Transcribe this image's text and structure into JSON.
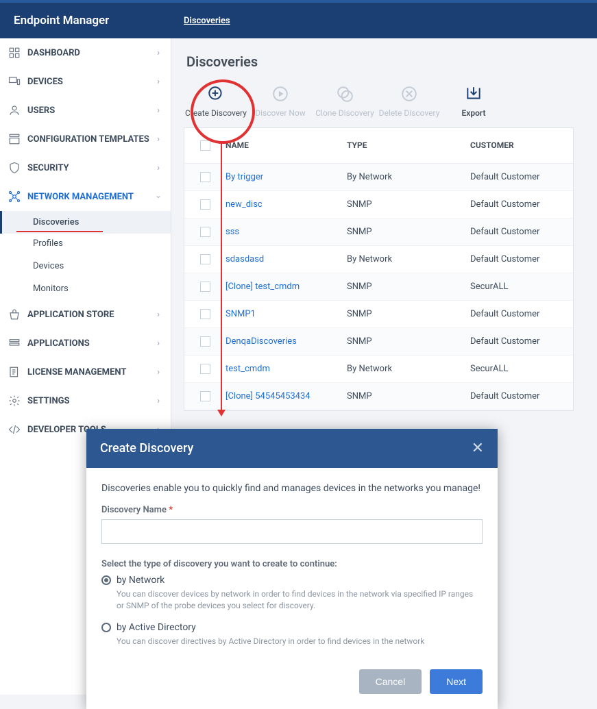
{
  "app": {
    "title": "Endpoint Manager"
  },
  "breadcrumb": {
    "label": "Discoveries"
  },
  "sidebar": {
    "items": [
      {
        "label": "DASHBOARD"
      },
      {
        "label": "DEVICES"
      },
      {
        "label": "USERS"
      },
      {
        "label": "CONFIGURATION TEMPLATES"
      },
      {
        "label": "SECURITY"
      },
      {
        "label": "NETWORK MANAGEMENT"
      },
      {
        "label": "APPLICATION STORE"
      },
      {
        "label": "APPLICATIONS"
      },
      {
        "label": "LICENSE MANAGEMENT"
      },
      {
        "label": "SETTINGS"
      },
      {
        "label": "DEVELOPER TOOLS"
      }
    ],
    "network_sub": [
      {
        "label": "Discoveries"
      },
      {
        "label": "Profiles"
      },
      {
        "label": "Devices"
      },
      {
        "label": "Monitors"
      }
    ]
  },
  "page": {
    "title": "Discoveries"
  },
  "toolbar": {
    "create": "Create Discovery",
    "discover_now": "Discover Now",
    "clone": "Clone Discovery",
    "delete": "Delete Discovery",
    "export": "Export"
  },
  "table": {
    "headers": {
      "name": "NAME",
      "type": "TYPE",
      "customer": "CUSTOMER"
    },
    "rows": [
      {
        "name": "By trigger",
        "type": "By Network",
        "customer": "Default Customer"
      },
      {
        "name": "new_disc",
        "type": "SNMP",
        "customer": "Default Customer"
      },
      {
        "name": "sss",
        "type": "SNMP",
        "customer": "Default Customer"
      },
      {
        "name": "sdasdasd",
        "type": "By Network",
        "customer": "Default Customer"
      },
      {
        "name": "[Clone] test_cmdm",
        "type": "SNMP",
        "customer": "SecurALL"
      },
      {
        "name": "SNMP1",
        "type": "SNMP",
        "customer": "Default Customer"
      },
      {
        "name": "DenqaDiscoveries",
        "type": "SNMP",
        "customer": "Default Customer"
      },
      {
        "name": "test_cmdm",
        "type": "By Network",
        "customer": "SecurALL"
      },
      {
        "name": "[Clone] 54545453434",
        "type": "SNMP",
        "customer": "Default Customer"
      }
    ]
  },
  "modal": {
    "title": "Create Discovery",
    "intro": "Discoveries enable you to quickly find and manages devices in the networks you manage!",
    "name_label": "Discovery Name",
    "required_mark": "*",
    "type_prompt": "Select the type of discovery you want to create to continue:",
    "opt_network": {
      "label": "by Network",
      "desc": "You can discover devices by network in order to find devices in the network via specified IP ranges or SNMP of the probe devices you select for discovery."
    },
    "opt_ad": {
      "label": "by Active Directory",
      "desc": "You can discover directives by Active Directory in order to find devices in the network"
    },
    "cancel": "Cancel",
    "next": "Next"
  }
}
